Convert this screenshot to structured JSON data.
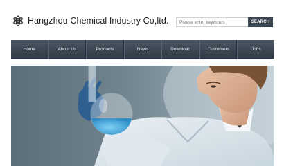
{
  "header": {
    "company_name": "Hangzhou Chemical Industry Co,ltd.",
    "logo_icon": "atom-logo-icon"
  },
  "search": {
    "placeholder": "Please enter keywords",
    "button_label": "SEARCH"
  },
  "nav": {
    "items": [
      "Home",
      "About Us",
      "Products",
      "News",
      "Download",
      "Customers",
      "Jobs"
    ]
  },
  "hero": {
    "image_subject": "scientist-with-flask-image"
  },
  "colors": {
    "nav_bg": "#3a4552",
    "search_button_bg": "#3a4552",
    "liquid": "#3aa0d8"
  }
}
